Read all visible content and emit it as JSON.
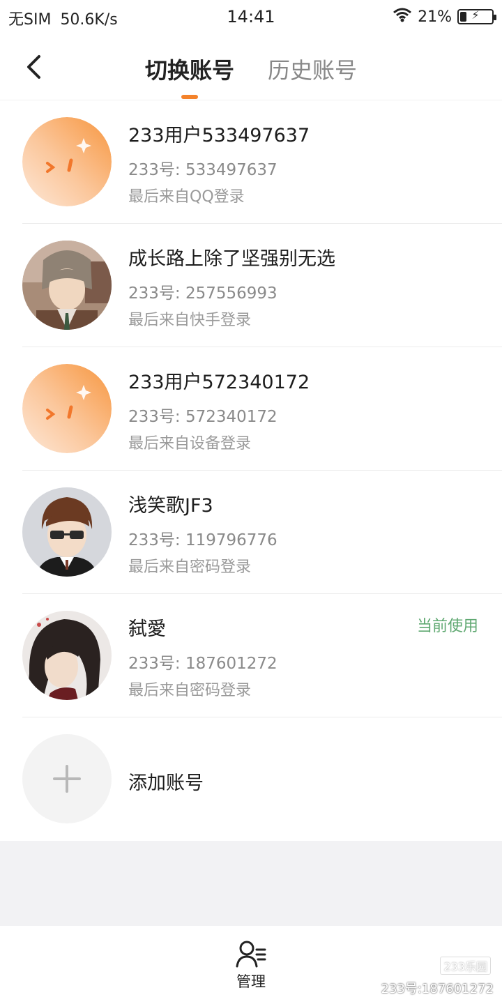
{
  "status_bar": {
    "carrier": "无SIM",
    "speed": "50.6K/s",
    "time": "14:41",
    "battery_percent": "21%",
    "battery_level": 0.21
  },
  "nav": {
    "tab_active": "切换账号",
    "tab_inactive": "历史账号"
  },
  "accounts": [
    {
      "name": "233用户533497637",
      "id_text": "233号: 533497637",
      "login_text": "最后来自QQ登录",
      "avatar": "mascot"
    },
    {
      "name": "成长路上除了坚强别无选",
      "id_text": "233号: 257556993",
      "login_text": "最后来自快手登录",
      "avatar": "photo-1"
    },
    {
      "name": "233用户572340172",
      "id_text": "233号: 572340172",
      "login_text": "最后来自设备登录",
      "avatar": "mascot"
    },
    {
      "name": "浅笑歌JF3",
      "id_text": "233号: 119796776",
      "login_text": "最后来自密码登录",
      "avatar": "photo-2"
    },
    {
      "name": "弑愛",
      "id_text": "233号: 187601272",
      "login_text": "最后来自密码登录",
      "avatar": "photo-3",
      "badge": "当前使用"
    }
  ],
  "add_account": {
    "label": "添加账号"
  },
  "bottom": {
    "manage_label": "管理"
  },
  "watermark": {
    "logo": "233乐园",
    "text": "233号:187601272"
  },
  "colors": {
    "accent": "#f4822a",
    "current": "#5fa871"
  },
  "icons": [
    "chevron-left-icon",
    "wifi-icon",
    "battery-icon",
    "plus-icon",
    "user-manage-icon"
  ]
}
